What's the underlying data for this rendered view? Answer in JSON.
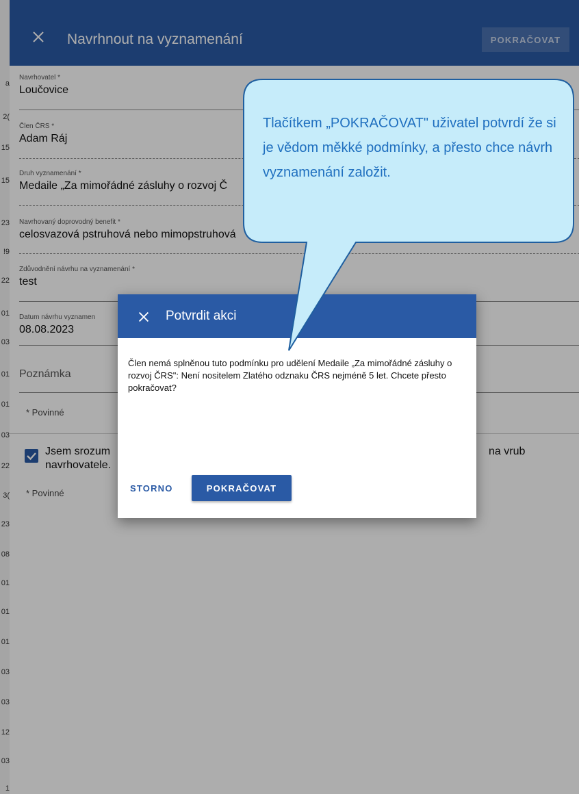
{
  "edge_digits": [
    "a",
    "2(",
    "15",
    "15",
    "23",
    "!9",
    "22",
    "01",
    "03",
    "01",
    "01",
    "03",
    "22",
    "3(",
    "23",
    "08",
    "01",
    "01",
    "01",
    "03",
    "03",
    "12",
    "03",
    "1"
  ],
  "form": {
    "title": "Navrhnout na vyznamenání",
    "continue_label": "POKRAČOVAT",
    "close_icon": "close-icon",
    "fields": {
      "navrhovatel": {
        "label": "Navrhovatel *",
        "value": "Loučovice"
      },
      "clen": {
        "label": "Člen ČRS *",
        "value": "Adam Ráj"
      },
      "druh": {
        "label": "Druh vyznamenání *",
        "value": "Medaile „Za mimořádné zásluhy o rozvoj Č"
      },
      "benefit": {
        "label": "Navrhovaný doprovodný benefit *",
        "value": "celosvazová pstruhová nebo mimopstruhová"
      },
      "zduvodneni": {
        "label": "Zdůvodnění návrhu na vyznamenání *",
        "value": "test"
      },
      "datum": {
        "label": "Datum návrhu vyznamen",
        "value": "08.08.2023"
      }
    },
    "note_label": "Poznámka",
    "required_1": "* Povinné",
    "checkbox_text_1": "Jsem srozum",
    "checkbox_text_1b": "na vrub",
    "checkbox_text_2": "navrhovatele.",
    "required_2": "* Povinné"
  },
  "modal": {
    "title": "Potvrdit akci",
    "close_icon": "close-icon",
    "message": "Člen nemá splněnou tuto podmínku pro udělení Medaile „Za mimořádné zásluhy o rozvoj ČRS\": Není nositelem Zlatého odznaku ČRS nejméně 5 let. Chcete přesto pokračovat?",
    "cancel_label": "STORNO",
    "confirm_label": "POKRAČOVAT"
  },
  "callout": {
    "text": "Tlačítkem „POKRAČOVAT\" uživatel potvrdí že si je vědom měkké podmínky, a přesto chce návrh vyznamenání založit."
  },
  "colors": {
    "primary": "#2a5aa5",
    "callout_fill": "#c6ecfa",
    "callout_border": "#1f5fa0",
    "callout_text": "#1f6fbf"
  }
}
